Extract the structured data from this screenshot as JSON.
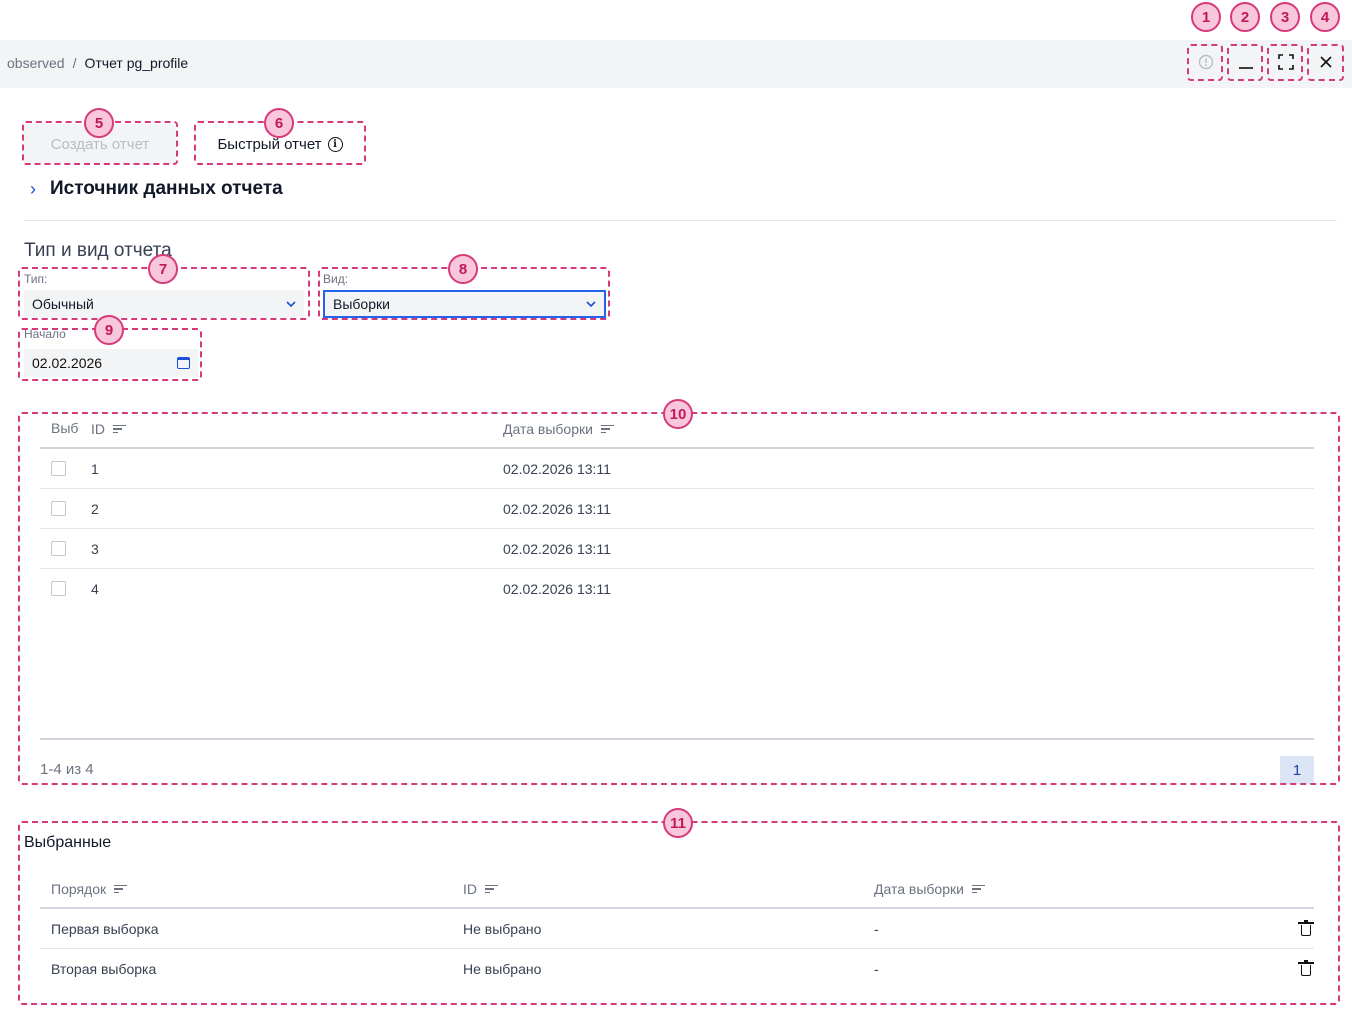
{
  "breadcrumb": {
    "parent": "observed",
    "separator": "/",
    "current": "Отчет pg_profile"
  },
  "window_controls": {
    "alert_icon": "alert-circle-icon",
    "minimize_icon": "minimize-icon",
    "expand_icon": "expand-icon",
    "close_icon": "close-icon"
  },
  "toolbar": {
    "create_label": "Создать отчет",
    "quick_label": "Быстрый отчет"
  },
  "data_source": {
    "title": "Источник данных отчета"
  },
  "report_type": {
    "title": "Тип и вид отчета",
    "type_label": "Тип:",
    "type_value": "Обычный",
    "view_label": "Вид:",
    "view_value": "Выборки",
    "start_label": "Начало",
    "start_value": "02.02.2026"
  },
  "samples_table": {
    "headers": {
      "select": "Выб",
      "id": "ID",
      "date": "Дата выборки"
    },
    "rows": [
      {
        "id": "1",
        "date": "02.02.2026 13:11"
      },
      {
        "id": "2",
        "date": "02.02.2026 13:11"
      },
      {
        "id": "3",
        "date": "02.02.2026 13:11"
      },
      {
        "id": "4",
        "date": "02.02.2026 13:11"
      }
    ],
    "pagination": {
      "info": "1-4 из 4",
      "page": "1"
    }
  },
  "selected": {
    "title": "Выбранные",
    "headers": {
      "order": "Порядок",
      "id": "ID",
      "date": "Дата выборки"
    },
    "rows": [
      {
        "order": "Первая выборка",
        "id": "Не выбрано",
        "date": "-"
      },
      {
        "order": "Вторая выборка",
        "id": "Не выбрано",
        "date": "-"
      }
    ]
  },
  "annotations": [
    "1",
    "2",
    "3",
    "4",
    "5",
    "6",
    "7",
    "8",
    "9",
    "10",
    "11"
  ],
  "colors": {
    "accent": "#1d4ed8",
    "annotation": "#d63a7a",
    "annotation_fill": "#f9c7dc"
  }
}
